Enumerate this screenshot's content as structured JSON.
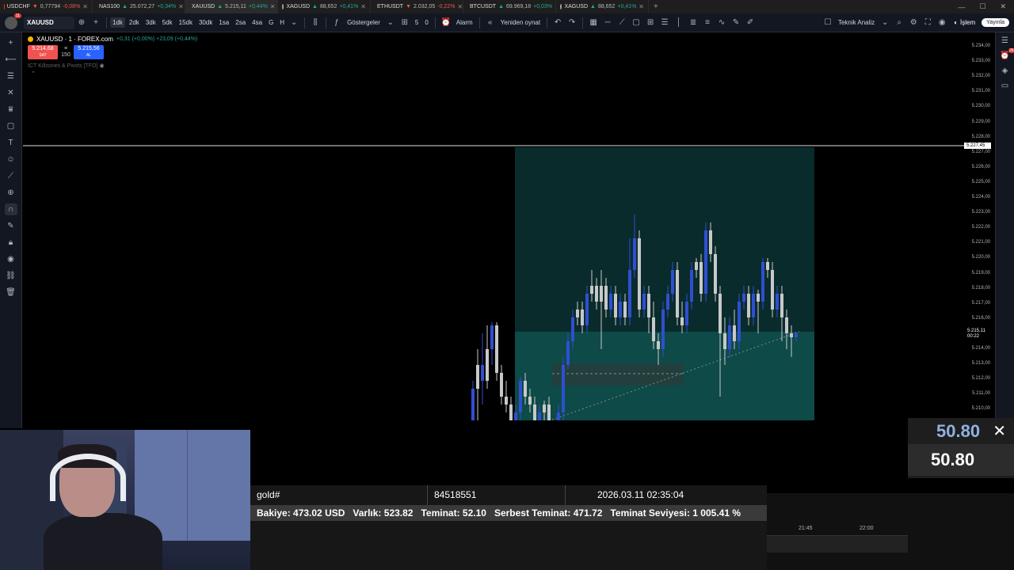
{
  "tabs": [
    {
      "symbol": "USDCHF",
      "price": "0,77794",
      "change": "-0,08%",
      "dir": "down",
      "color": "#e53935"
    },
    {
      "symbol": "NAS100",
      "price": "25.072,27",
      "change": "+0,34%",
      "dir": "up",
      "color": "#2962ff"
    },
    {
      "symbol": "XAUUSD",
      "price": "5.215,11",
      "change": "+0,44%",
      "dir": "up",
      "color": "#f5b300",
      "active": true
    },
    {
      "symbol": "XAGUSD",
      "price": "88,652",
      "change": "+0,41%",
      "dir": "up",
      "color": "#9e9e9e"
    },
    {
      "symbol": "ETHUSDT",
      "price": "2.032,05",
      "change": "-0,22%",
      "dir": "down",
      "color": "#627eea"
    },
    {
      "symbol": "BTCUSDT",
      "price": "69.969,18",
      "change": "+0,03%",
      "dir": "up",
      "color": "#f7931a"
    },
    {
      "symbol": "XAGUSD",
      "price": "88,652",
      "change": "+0,41%",
      "dir": "up",
      "color": "#9e9e9e"
    }
  ],
  "avatar_badge": "11",
  "toolbar": {
    "symbol": "XAUUSD",
    "timeframes": [
      "1dk",
      "2dk",
      "3dk",
      "5dk",
      "15dk",
      "30dk",
      "1sa",
      "2sa",
      "4sa",
      "G",
      "H"
    ],
    "active_timeframe": "1dk",
    "indicators_label": "Göstergeler",
    "alarm_label": "Alarm",
    "replay_label": "Yeniden oynat",
    "analysis_label": "Teknik Analiz",
    "trade_label": "İşlem",
    "publish_label": "Yayınla",
    "counts": [
      "5",
      "0"
    ]
  },
  "legend": {
    "title": "XAUUSD · 1 · FOREX.com",
    "change": "+0,31 (+0,00%)  +23,09 (+0,44%)",
    "sell_price": "5.214,68",
    "sell_label": "SAT",
    "spread": "150",
    "buy_price": "5.215,56",
    "buy_label": "AL",
    "indicator": "ICT Killzones & Pivots [TFO]"
  },
  "right_badge": "26",
  "price_axis": {
    "ticks": [
      "5.234,00",
      "5.233,00",
      "5.232,00",
      "5.231,00",
      "5.230,00",
      "5.229,00",
      "5.228,00",
      "5.227,00",
      "5.226,00",
      "5.225,00",
      "5.224,00",
      "5.223,00",
      "5.222,00",
      "5.221,00",
      "5.220,00",
      "5.219,00",
      "5.218,00",
      "5.217,00",
      "5.216,00",
      "5.215,00",
      "5.214,00",
      "5.213,00",
      "5.212,00",
      "5.211,00",
      "5.210,00"
    ],
    "hline_label": "5.227,45",
    "last_price": "5.215,11",
    "countdown": "00:22"
  },
  "time_axis": [
    "21:45",
    "22:00"
  ],
  "overlay": {
    "account": "gold#",
    "login": "84518551",
    "datetime": "2026.03.11 02:35:04",
    "balance": "Bakiye: 473.02 USD",
    "equity": "Varlık: 523.82",
    "margin": "Teminat: 52.10",
    "free_margin": "Serbest Teminat: 471.72",
    "margin_level": "Teminat Seviyesi: 1 005.41 %"
  },
  "volume_panel": {
    "value_top": "50.80",
    "value_bottom": "50.80"
  }
}
